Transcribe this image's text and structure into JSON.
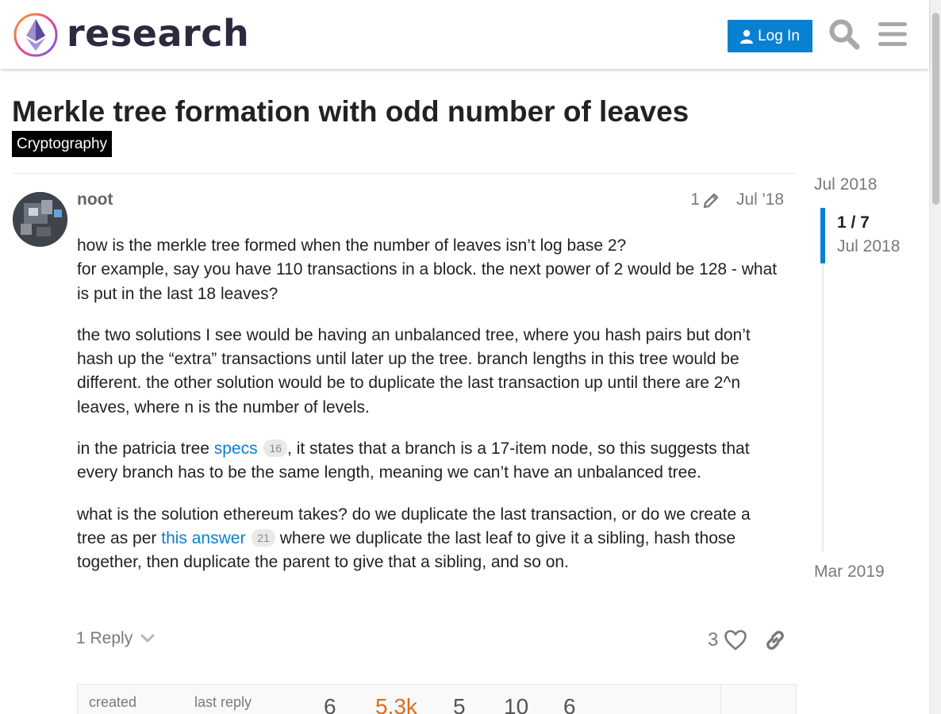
{
  "header": {
    "logo_text": "research",
    "login_label": "Log In"
  },
  "topic": {
    "title": "Merkle tree formation with odd number of leaves",
    "category": "Cryptography"
  },
  "post": {
    "username": "noot",
    "edit_count": "1",
    "date": "Jul '18",
    "paragraphs": {
      "p1_line1": "how is the merkle tree formed when the number of leaves isn’t log base 2?",
      "p1_line2": "for example, say you have 110 transactions in a block. the next power of 2 would be 128 - what is put in the last 18 leaves?",
      "p2": "the two solutions I see would be having an unbalanced tree, where you hash pairs but don’t hash up the “extra” transactions until later up the tree. branch lengths in this tree would be different. the other solution would be to duplicate the last transaction up until there are 2^n leaves, where n is the number of levels.",
      "p3_before": "in the patricia tree ",
      "p3_link": "specs",
      "p3_link_count": "16",
      "p3_after": ", it states that a branch is a 17-item node, so this suggests that every branch has to be the same length, meaning we can’t have an unbalanced tree.",
      "p4_before": "what is the solution ethereum takes? do we duplicate the last transaction, or do we create a tree as per ",
      "p4_link": "this answer",
      "p4_link_count": "21",
      "p4_after": " where we duplicate the last leaf to give it a sibling, hash those together, then duplicate the parent to give that a sibling, and so on."
    },
    "actions": {
      "replies_label": "1 Reply",
      "like_count": "3"
    }
  },
  "topic_map": {
    "created_label": "created",
    "last_reply_label": "last reply",
    "replies": "6",
    "views": "5.3k",
    "users": "5",
    "likes": "10",
    "links": "6"
  },
  "timeline": {
    "start_date": "Jul 2018",
    "position": "1 / 7",
    "current_date": "Jul 2018",
    "end_date": "Mar 2019"
  },
  "colors": {
    "accent": "#0a80d1",
    "category_bg": "#000000",
    "views_hot": "#d96d1f"
  }
}
